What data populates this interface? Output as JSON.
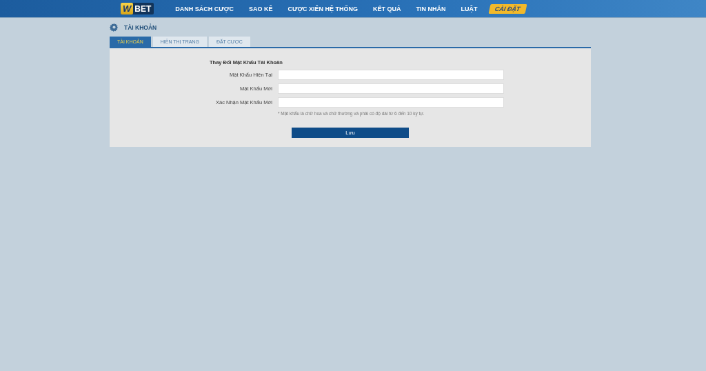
{
  "header": {
    "logo": {
      "mark": "W",
      "text": "BET"
    },
    "nav": [
      {
        "label": "DANH SÁCH CƯỢC",
        "selected": false
      },
      {
        "label": "SAO KÊ",
        "selected": false
      },
      {
        "label": "CƯỢC XIÊN HỆ THỐNG",
        "selected": false
      },
      {
        "label": "KẾT QUẢ",
        "selected": false
      },
      {
        "label": "TIN NHẮN",
        "selected": false
      },
      {
        "label": "LUẬT",
        "selected": false
      },
      {
        "label": "CÀI ĐẶT",
        "selected": true
      }
    ]
  },
  "page_title": "TÀI KHOẢN",
  "tabs": [
    {
      "label": "TÀI KHOẢN",
      "selected": true
    },
    {
      "label": "HIỂN THỊ TRANG",
      "selected": false
    },
    {
      "label": "ĐẶT CƯỢC",
      "selected": false
    }
  ],
  "form": {
    "heading": "Thay Đổi Mật Khẩu Tài Khoản",
    "fields": [
      {
        "label": "Mật Khẩu Hiện Tại"
      },
      {
        "label": "Mật Khẩu Mới"
      },
      {
        "label": "Xác Nhận Mật Khẩu Mới"
      }
    ],
    "note": "* Mật khẩu là chữ hoa và chữ thường và phải có độ dài từ 6 đến 10 ký tự.",
    "submit": "Lưu"
  }
}
